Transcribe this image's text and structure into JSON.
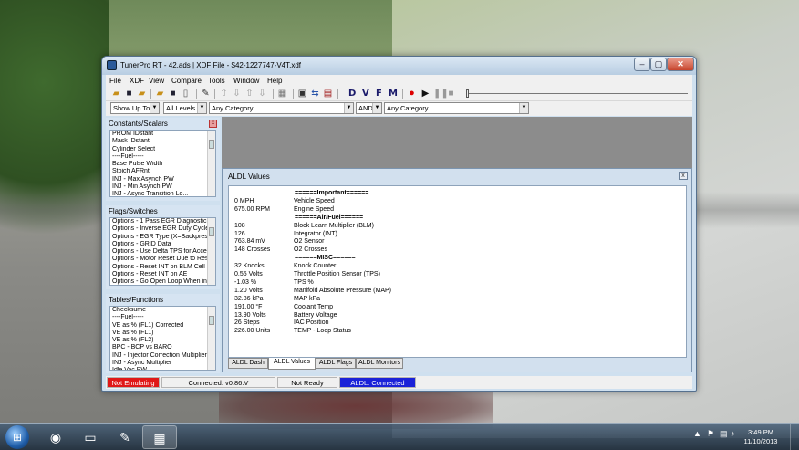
{
  "window": {
    "title": "TunerPro RT - 42.ads | XDF File - $42-1227747-V4T.xdf",
    "min": "–",
    "max": "▢",
    "close": "✕"
  },
  "menu": [
    "File",
    "XDF",
    "View",
    "Compare",
    "Tools",
    "Window",
    "Help"
  ],
  "toolbar": {
    "letters": [
      "D",
      "V",
      "F",
      "M"
    ]
  },
  "filters": {
    "show": "Show Up To",
    "levels": "All Levels",
    "category1": "Any Category",
    "logic": "AND",
    "category2": "Any Category"
  },
  "panels": {
    "constants": {
      "title": "Constants/Scalars",
      "items": [
        "PROM IDstant",
        "Mask IDstant",
        "Cylinder Select",
        "----Fuel-----",
        "Base Pulse Width",
        "Stoich AFRnt",
        "INJ - Max Asynch PW",
        "INJ - Min Asynch PW",
        "INJ - Async Transition Lo..."
      ]
    },
    "flags": {
      "title": "Flags/Switches",
      "items": [
        "Options - 1 Pass EGR Diagnostic",
        "Options - Inverse EGR Duty Cycle",
        "Options - EGR Type (X=Backpress",
        "Options - GRID Data",
        "Options - Use Delta TPS for Accel",
        "Options - Motor Reset Due to Res",
        "Options - Reset INT on BLM Cell C",
        "Options - Reset INT on AE",
        "Options - Go Open Loop When in I"
      ]
    },
    "tables": {
      "title": "Tables/Functions",
      "items": [
        "Checksume",
        "----Fuel-----",
        "VE as % (FL1) Corrected",
        "VE as % (FL1)",
        "VE as % (FL2)",
        "BPC - BCP vs BARO",
        "INJ - Injector Correction Multiplier",
        "INJ - Async Multiplier",
        "Idle Vac PW..."
      ]
    }
  },
  "aldl": {
    "title": "ALDL Values",
    "close": "x",
    "sections": [
      {
        "header": "======Important======"
      },
      {
        "value": "0 MPH",
        "name": "Vehicle Speed"
      },
      {
        "value": "675.00 RPM",
        "name": "Engine Speed"
      },
      {
        "header": "======Air/Fuel======"
      },
      {
        "value": "108",
        "name": "Block Learn Multiplier (BLM)"
      },
      {
        "value": "126",
        "name": "Integrator (INT)"
      },
      {
        "value": "763.84 mV",
        "name": "O2 Sensor"
      },
      {
        "value": "148 Crosses",
        "name": "O2 Crosses"
      },
      {
        "header": "======MISC======"
      },
      {
        "value": "32 Knocks",
        "name": "Knock Counter"
      },
      {
        "value": "0.55 Volts",
        "name": "Throttle Position Sensor (TPS)"
      },
      {
        "value": "-1.03 %",
        "name": "TPS %"
      },
      {
        "value": "1.20 Volts",
        "name": "Manifold Absolute Pressure (MAP)"
      },
      {
        "value": "32.86 kPa",
        "name": "MAP kPa"
      },
      {
        "value": "191.00 °F",
        "name": "Coolant Temp"
      },
      {
        "value": "13.90 Volts",
        "name": "Battery Voltage"
      },
      {
        "value": "26 Steps",
        "name": "IAC Position"
      },
      {
        "value": "226.00 Units",
        "name": "TEMP - Loop Status"
      }
    ],
    "tabs": [
      "ALDL Dash",
      "ALDL Values",
      "ALDL Flags",
      "ALDL Monitors"
    ],
    "active_tab": "ALDL Values"
  },
  "status": {
    "emulating": "Not Emulating",
    "connected": "Connected: v0.86.V",
    "ready": "Not Ready",
    "aldl": "ALDL: Connected"
  },
  "taskbar": {
    "time": "3:49 PM",
    "date": "11/10/2013"
  },
  "colors": {
    "status_red": "#e01818",
    "status_blue": "#1a22d8"
  }
}
